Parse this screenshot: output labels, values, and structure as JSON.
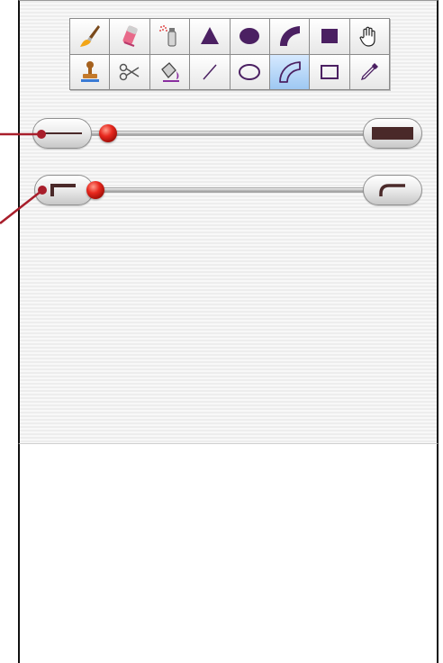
{
  "colors": {
    "accent": "#4b2062",
    "knob": "#d62a1c",
    "callout": "#a81e2b",
    "selected": "#a9cff3",
    "stroke_preview": "#4a2929"
  },
  "toolbar": {
    "rows": [
      [
        {
          "icon": "paintbrush-icon",
          "tool": "paintbrush"
        },
        {
          "icon": "eraser-icon",
          "tool": "eraser"
        },
        {
          "icon": "spray-can-icon",
          "tool": "spray-can"
        },
        {
          "icon": "triangle-icon",
          "tool": "filled-polygon"
        },
        {
          "icon": "filled-ellipse-icon",
          "tool": "filled-ellipse"
        },
        {
          "icon": "filled-arc-icon",
          "tool": "filled-arc"
        },
        {
          "icon": "filled-rectangle-icon",
          "tool": "filled-rectangle"
        },
        {
          "icon": "hand-icon",
          "tool": "hand"
        }
      ],
      [
        {
          "icon": "stamp-icon",
          "tool": "stamp"
        },
        {
          "icon": "scissors-icon",
          "tool": "scissors"
        },
        {
          "icon": "paint-bucket-icon",
          "tool": "paint-bucket"
        },
        {
          "icon": "line-icon",
          "tool": "line"
        },
        {
          "icon": "ellipse-outline-icon",
          "tool": "ellipse-outline"
        },
        {
          "icon": "arc-outline-icon",
          "tool": "arc-outline"
        },
        {
          "icon": "rectangle-outline-icon",
          "tool": "rectangle-outline"
        },
        {
          "icon": "eyedropper-icon",
          "tool": "eyedropper"
        }
      ]
    ],
    "selected_tool": "arc-outline"
  },
  "sliders": {
    "line_width": {
      "value": 0.05,
      "min_icon": "thin-line-icon",
      "max_icon": "thick-line-icon"
    },
    "corner_radius": {
      "value": 0.0,
      "min_icon": "square-corner-icon",
      "max_icon": "round-corner-icon"
    }
  }
}
